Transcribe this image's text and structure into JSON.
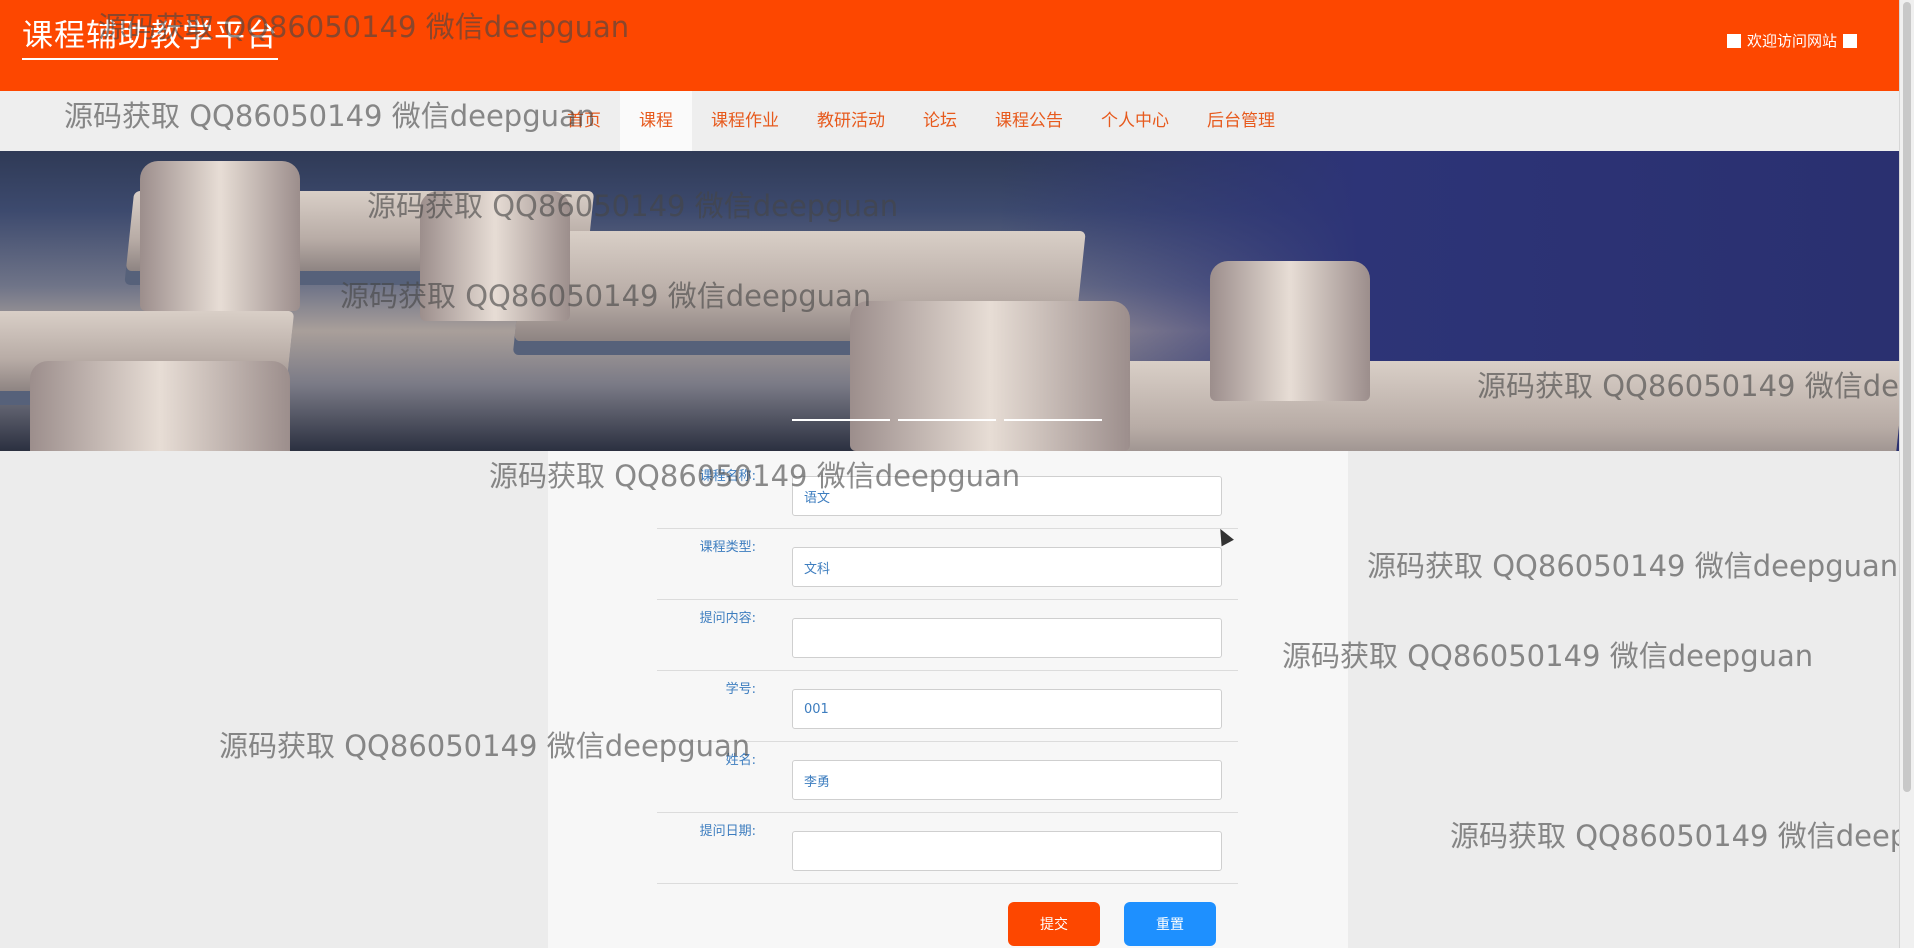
{
  "header": {
    "site_title": "课程辅助教学平台",
    "welcome_text": "欢迎访问网站"
  },
  "nav": {
    "items": [
      {
        "label": "首页"
      },
      {
        "label": "课程"
      },
      {
        "label": "课程作业"
      },
      {
        "label": "教研活动"
      },
      {
        "label": "论坛"
      },
      {
        "label": "课程公告"
      },
      {
        "label": "个人中心"
      },
      {
        "label": "后台管理"
      }
    ],
    "active": "课程"
  },
  "banner": {
    "slide_count": 3
  },
  "form": {
    "fields": [
      {
        "label": "课程名称:",
        "value": "语文"
      },
      {
        "label": "课程类型:",
        "value": "文科"
      },
      {
        "label": "提问内容:",
        "value": ""
      },
      {
        "label": "学号:",
        "value": "001"
      },
      {
        "label": "姓名:",
        "value": "李勇"
      },
      {
        "label": "提问日期:",
        "value": ""
      }
    ],
    "submit_label": "提交",
    "reset_label": "重置"
  },
  "watermark": {
    "text": "源码获取 QQ86050149 微信deepguan"
  },
  "colors": {
    "brand": "#fd4700",
    "nav_text": "#e75a1d",
    "reset_button": "#1e90ff",
    "label_text": "#3d7dbf"
  }
}
